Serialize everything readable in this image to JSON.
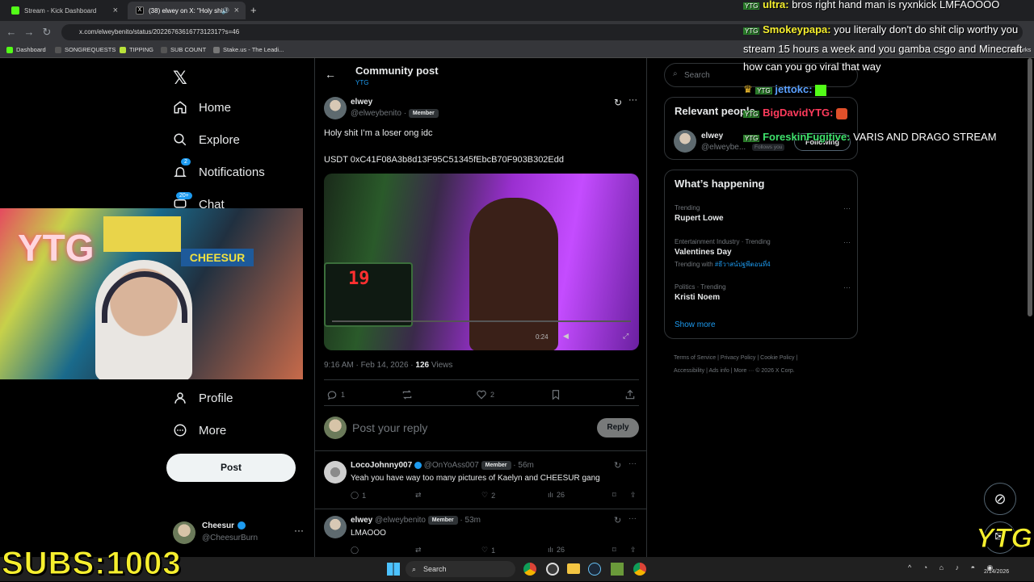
{
  "browser": {
    "tabs": [
      {
        "label": "Stream - Kick Dashboard",
        "icon": "kick-icon"
      },
      {
        "label": "(38) elwey on X: \"Holy shit i",
        "icon": "x-icon"
      }
    ],
    "url": "x.com/elweybenito/status/2022676361677312317?s=46",
    "bookmarks": [
      "Dashboard",
      "SONGREQUESTS",
      "TIPPING",
      "SUB COUNT",
      "Stake.us - The Leadi..."
    ],
    "bookmarks_right": "okmarks"
  },
  "left_nav": {
    "items": [
      {
        "label": "Home",
        "icon": "home-icon"
      },
      {
        "label": "Explore",
        "icon": "search-icon"
      },
      {
        "label": "Notifications",
        "icon": "bell-icon",
        "badge": "2"
      },
      {
        "label": "Chat",
        "icon": "chat-icon",
        "badge": "20+"
      },
      {
        "label": "Profile",
        "icon": "person-icon"
      },
      {
        "label": "More",
        "icon": "more-circle-icon"
      }
    ],
    "post_label": "Post",
    "account": {
      "name": "Cheesur",
      "handle": "@CheesurBurn"
    }
  },
  "post": {
    "header_title": "Community post",
    "header_sub": "YTG",
    "author": "elwey",
    "handle": "@elweybenito",
    "role": "Member",
    "text1": "Holy shit I’m a loser ong idc",
    "text2": "USDT 0xC41F08A3b8d13F95C51345fEbcB70F903B302Edd",
    "time": "9:16 AM · Feb 14, 2026 · ",
    "views_count": "126",
    "views_label": " Views",
    "replies": "1",
    "likes": "2",
    "video_time": "0:24",
    "reply_placeholder": "Post your reply",
    "reply_button": "Reply"
  },
  "replies": [
    {
      "name": "LocoJohnny007",
      "handle": "@OnYoAss007",
      "role": "Member",
      "age": "56m",
      "text": "Yeah you have way too many pictures of Kaelyn and CHEESUR gang",
      "replies": "1",
      "likes": "2",
      "views": "26"
    },
    {
      "name": "elwey",
      "handle": "@elweybenito",
      "role": "Member",
      "age": "53m",
      "text": "LMAOOO",
      "replies": "",
      "likes": "1",
      "views": "26"
    }
  ],
  "right": {
    "search_placeholder": "Search",
    "relevant_title": "Relevant people",
    "person": {
      "name": "elwey",
      "handle": "@elweybe...",
      "follows": "Follows you",
      "button": "Following"
    },
    "happening_title": "What’s happening",
    "trends": [
      {
        "meta": "Trending",
        "title": "Rupert Lowe",
        "extra": ""
      },
      {
        "meta": "Entertainment Industry · Trending",
        "title": "Valentines Day",
        "extra_prefix": "Trending with ",
        "extra": "#ธีวาสน์ปฐพีตอนที่4"
      },
      {
        "meta": "Politics · Trending",
        "title": "Kristi Noem",
        "extra": ""
      }
    ],
    "show_more": "Show more",
    "footer": [
      "Terms of Service",
      "Privacy Policy",
      "Cookie Policy",
      "Accessibility",
      "Ads info",
      "More ···",
      "© 2026 X Corp."
    ]
  },
  "stream_chat": [
    {
      "badge": "YTG",
      "name": "ultra:",
      "name_color": "#f6ef2e",
      "msg": "bros right hand man is ryxnkick LMFAOOOO"
    },
    {
      "badge": "YTG",
      "name": "Smokeypapa:",
      "name_color": "#f6ef2e",
      "msg": "you literally don't do shit clip worthy you stream 15 hours a week and you gamba csgo and Minecraft how can you go viral that way"
    },
    {
      "badge": "YTG",
      "name": "jettokc:",
      "name_color": "#5aa0ff",
      "msg": ""
    },
    {
      "badge": "YTG",
      "name": "BigDavidYTG:",
      "name_color": "#ff3b5c",
      "msg": ""
    },
    {
      "badge": "YTG",
      "name": "ForeskinFugitive:",
      "name_color": "#3ee06b",
      "msg": "VARIS AND DRAGO STREAM"
    }
  ],
  "overlay": {
    "subs": "SUBS:1003",
    "logo": "YTG",
    "webcam_sign": "YTG",
    "webcam_banner": "CHEESUR"
  },
  "taskbar": {
    "search": "Search",
    "date": "2/14/2026"
  }
}
